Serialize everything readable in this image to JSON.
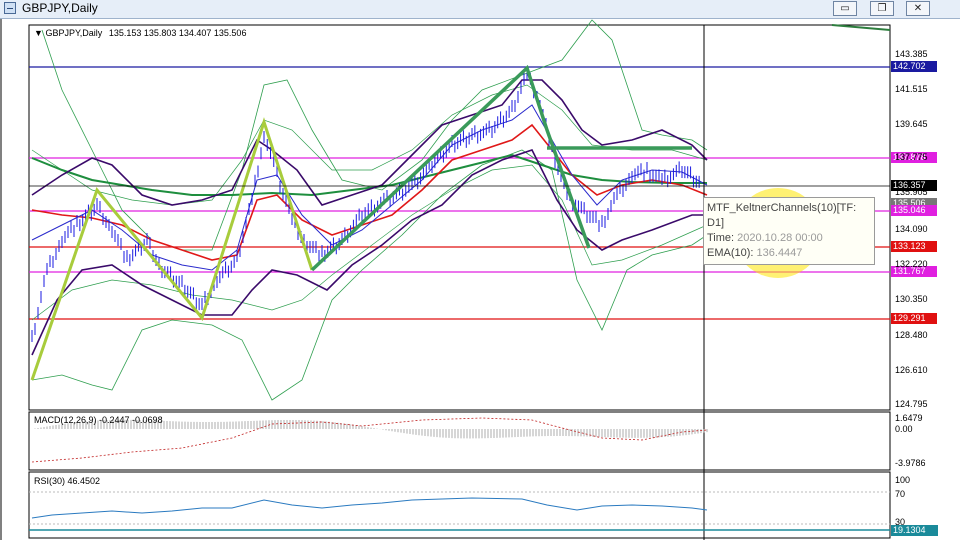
{
  "window": {
    "title": "GBPJPY,Daily",
    "minimize": "▭",
    "restore": "❐",
    "close": "✕"
  },
  "main_header": {
    "symbol": "GBPJPY,Daily",
    "ohlc": "135.153 135.803 134.407 135.506"
  },
  "price_axis": [
    "143.385",
    "141.515",
    "139.645",
    "137.775",
    "135.905",
    "134.090",
    "132.220",
    "130.350",
    "128.480",
    "126.610",
    "124.795"
  ],
  "hlines": [
    {
      "label": "142.702",
      "color": "#1a1aa0"
    },
    {
      "label": "137.878",
      "color": "#e020e0"
    },
    {
      "label": "136.357",
      "color": "#000000"
    },
    {
      "label": "135.506",
      "color": "#777777"
    },
    {
      "label": "135.046",
      "color": "#e020e0"
    },
    {
      "label": "133.123",
      "color": "#e01010"
    },
    {
      "label": "131.767",
      "color": "#e020e0"
    },
    {
      "label": "129.291",
      "color": "#e01010"
    }
  ],
  "macd": {
    "header": "MACD(12,26,9) -0.2447 -0.0698",
    "axis": [
      "1.6479",
      "0.00",
      "-3.9786"
    ]
  },
  "rsi": {
    "header": "RSI(30) 46.4502",
    "axis": [
      "100",
      "70",
      "30"
    ],
    "badge": "19.1304"
  },
  "tooltip": {
    "line1": "MTF_KeltnerChannels(10)[TF:",
    "line2": "D1]",
    "time_label": "Time:",
    "time_value": "2020.10.28 00:00",
    "ema_label": "EMA(10):",
    "ema_value": "136.4447"
  },
  "colors": {
    "green_band": "#2e9e4e",
    "purple_band": "#3a0a6a",
    "red_ema": "#e01818",
    "trend_lime": "#a8cc3c",
    "trend_green": "#3a9a5a",
    "candle": "#1a1ae0"
  }
}
